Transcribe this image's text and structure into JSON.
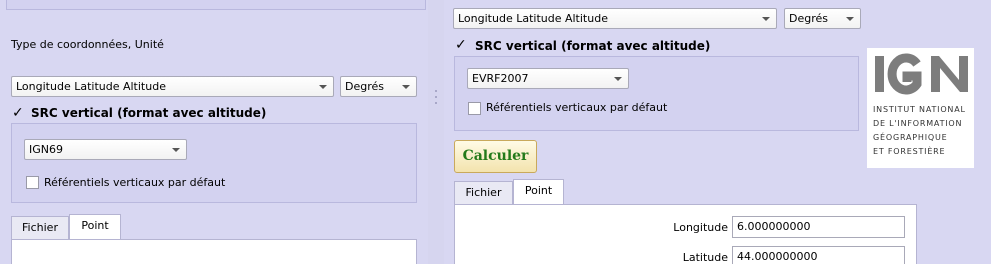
{
  "left": {
    "coord_type_label": "Type de coordonnées, Unité",
    "coord_type_value": "Longitude Latitude Altitude",
    "unit_value": "Degrés",
    "vertical_src_label": "SRC vertical (format avec altitude)",
    "vertical_ref_value": "IGN69",
    "default_refs_label": "Référentiels verticaux par défaut",
    "tabs": [
      "Fichier",
      "Point"
    ]
  },
  "right": {
    "coord_type_value": "Longitude Latitude Altitude",
    "unit_value": "Degrés",
    "vertical_src_label": "SRC vertical (format avec altitude)",
    "vertical_ref_value": "EVRF2007",
    "default_refs_label": "Référentiels verticaux par défaut",
    "calc_button": "Calculer",
    "tabs": [
      "Fichier",
      "Point"
    ],
    "longitude_label": "Longitude",
    "longitude_value": "6.000000000",
    "latitude_label": "Latitude",
    "latitude_value": "44.000000000"
  },
  "logo": {
    "letters": "IGN",
    "lines": [
      "INSTITUT NATIONAL",
      "DE L'INFORMATION",
      "GÉOGRAPHIQUE",
      "ET FORESTIÈRE"
    ]
  }
}
